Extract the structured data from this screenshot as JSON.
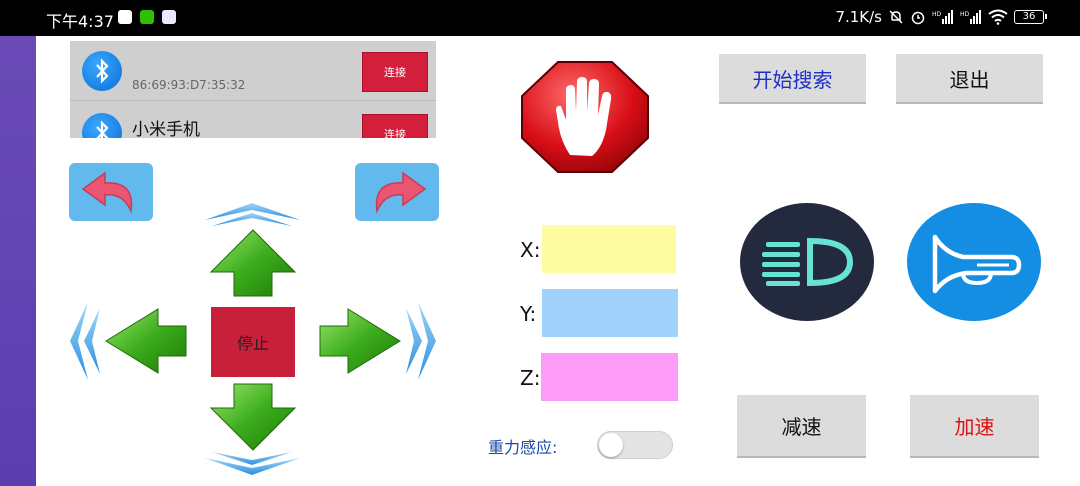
{
  "status_bar": {
    "time": "下午4:37",
    "net_speed": "7.1K/s",
    "signal1": "HD",
    "signal2": "HD",
    "battery": "36"
  },
  "device_list": {
    "items": [
      {
        "name": "",
        "address": "86:69:93:D7:35:32",
        "connect_label": "连接"
      },
      {
        "name": "小米手机",
        "address": "",
        "connect_label": "连接"
      }
    ]
  },
  "controls": {
    "stop_label": "停止"
  },
  "axes": {
    "x_label": "X:",
    "y_label": "Y:",
    "z_label": "Z:",
    "x_color": "#fdfca2",
    "y_color": "#a0d2fb",
    "z_color": "#fc9cf8"
  },
  "gravity": {
    "label": "重力感应:",
    "enabled": false
  },
  "buttons": {
    "search_label": "开始搜索",
    "exit_label": "退出",
    "slow_label": "减速",
    "fast_label": "加速"
  },
  "icons": {
    "headlight": "headlight-icon",
    "horn": "horn-icon",
    "stop_hand": "stop-hand-icon",
    "bluetooth": "bluetooth-icon"
  }
}
